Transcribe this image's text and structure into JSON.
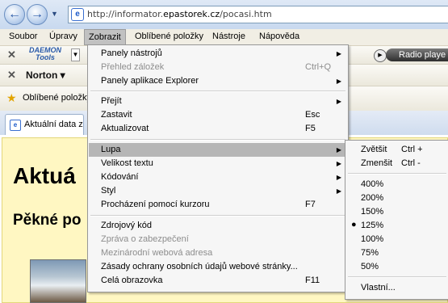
{
  "address_bar": {
    "url_prefix": "http://informator.",
    "url_domain": "epastorek.cz",
    "url_suffix": "/pocasi.htm"
  },
  "menubar": [
    "Soubor",
    "Úpravy",
    "Zobrazit",
    "Oblíbené položky",
    "Nástroje",
    "Nápověda"
  ],
  "toolbars": {
    "daemon_line1": "DAEMON",
    "daemon_line2": "Tools",
    "norton": "Norton",
    "favorites_label": "Oblíbené položky",
    "radio_label": "Radio playe"
  },
  "tab": {
    "label": "Aktuální data z"
  },
  "page": {
    "heading1": "Aktuá",
    "heading2": "Pěkné po"
  },
  "view_menu": {
    "group1": [
      {
        "label": "Panely nástrojů",
        "arrow": "▶"
      },
      {
        "label": "Přehled záložek",
        "shortcut": "Ctrl+Q",
        "disabled": true
      },
      {
        "label": "Panely aplikace Explorer",
        "arrow": "▶"
      }
    ],
    "group2": [
      {
        "label": "Přejít",
        "arrow": "▶"
      },
      {
        "label": "Zastavit",
        "shortcut": "Esc"
      },
      {
        "label": "Aktualizovat",
        "shortcut": "F5"
      }
    ],
    "group3": [
      {
        "label": "Lupa",
        "arrow": "▶",
        "highlighted": true
      },
      {
        "label": "Velikost textu",
        "arrow": "▶"
      },
      {
        "label": "Kódování",
        "arrow": "▶"
      },
      {
        "label": "Styl",
        "arrow": "▶"
      },
      {
        "label": "Procházení pomocí kurzoru",
        "shortcut": "F7"
      }
    ],
    "group4": [
      {
        "label": "Zdrojový kód"
      },
      {
        "label": "Zpráva o zabezpečení",
        "disabled": true
      },
      {
        "label": "Mezinárodní webová adresa",
        "disabled": true
      },
      {
        "label": "Zásady ochrany osobních údajů webové stránky..."
      },
      {
        "label": "Celá obrazovka",
        "shortcut": "F11"
      }
    ]
  },
  "zoom_submenu": {
    "zoom_in": {
      "label": "Zvětšit",
      "shortcut": "Ctrl +"
    },
    "zoom_out": {
      "label": "Zmenšit",
      "shortcut": "Ctrl -"
    },
    "levels": [
      "400%",
      "200%",
      "150%",
      "125%",
      "100%",
      "75%",
      "50%"
    ],
    "selected": "125%",
    "custom": "Vlastní..."
  }
}
